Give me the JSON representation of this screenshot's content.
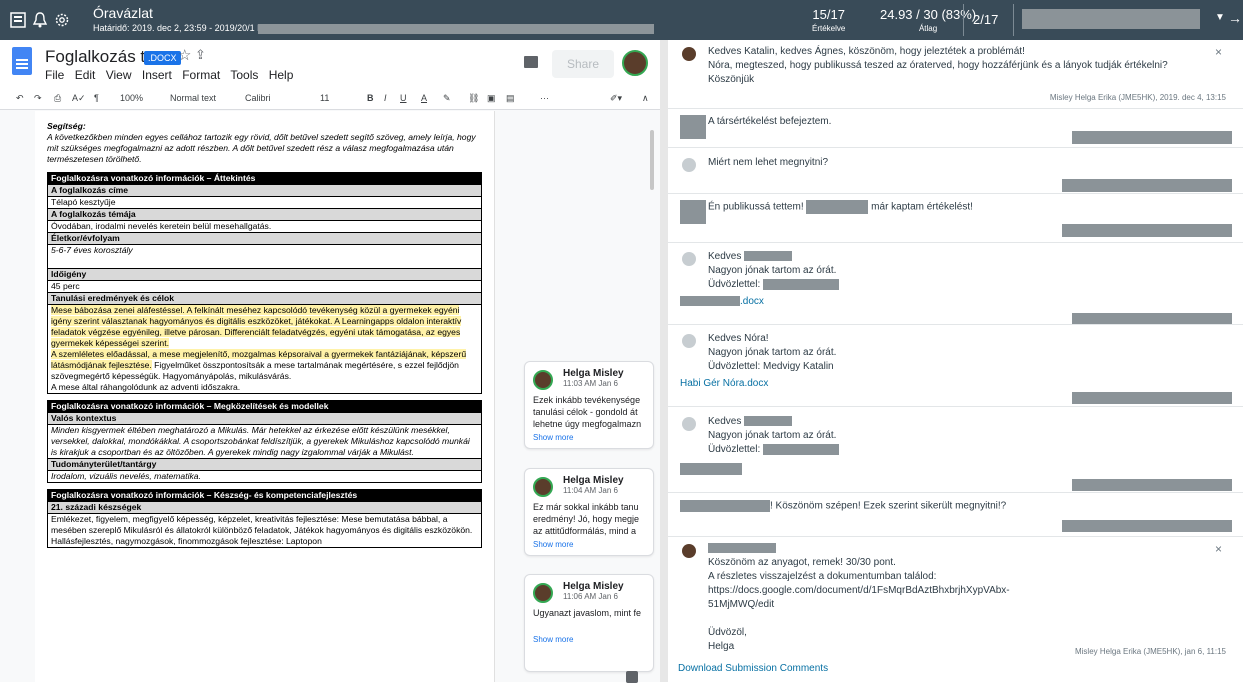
{
  "topbar": {
    "assignment_title": "Óravázlat",
    "deadline": "Határidő: 2019. dec 2, 23:59 - 2019/20/1 PPK-",
    "graded_count": "15/17",
    "graded_label": "Értékelve",
    "score": "24.93 / 30 (83%)",
    "score_label": "Átlag",
    "student_pos": "2/17"
  },
  "doc": {
    "title": "Foglalkozás terv",
    "badge": ".DOCX",
    "menu": [
      "File",
      "Edit",
      "View",
      "Insert",
      "Format",
      "Tools",
      "Help"
    ],
    "share_label": "Share",
    "toolbar": {
      "zoom": "100%",
      "style": "Normal text",
      "font": "Calibri",
      "size": "11",
      "bold": "B",
      "italic": "I",
      "underline": "U",
      "color": "A",
      "more": "···"
    },
    "help_title": "Segítség:",
    "help_text": "A következőkben minden egyes cellához tartozik egy rövid, dőlt betűvel szedett segítő szöveg, amely leírja, hogy mit szükséges megfogalmazni az adott részben. A dőlt betűvel szedett rész a válasz megfogalmazása után természetesen törölhető.",
    "s1_head": "Foglalkozásra vonatkozó információk – Áttekintés",
    "r_cim": "A foglalkozás címe",
    "v_cim": "Télapó kesztyűje",
    "r_tema": "A foglalkozás témája",
    "v_tema": "Óvodában, irodalmi nevelés keretein belül mesehallgatás.",
    "r_kor": "Életkor/évfolyam",
    "v_kor": "5-6-7 éves korosztály",
    "r_ido": "Időigény",
    "v_ido": "45 perc",
    "r_cel": "Tanulási eredmények és célok",
    "v_cel1": "Mese bábozása zenei aláfestéssel. A felkínált meséhez kapcsolódó tevékenység közül a gyermekek egyéni igény szerint választanak hagyományos és digitális eszközöket, játékokat. A Learningapps oldalon interaktív feladatok végzése egyénileg, illetve párosan. Differenciált feladatvégzés, egyéni utak támogatása, az egyes gyermekek képességei szerint.",
    "v_cel2a": "A szemléletes előadással, a mese megjelenítő, mozgalmas képsoraival a gyermekek fantáziájának, képszerű látásmódjának fejlesztése.",
    "v_cel2b": " Figyelműket összpontosítsák a mese tartalmának megértésére, s ezzel fejlődjön szövegmegértő képességük. Hagyományápolás, mikulásvárás.",
    "v_cel3": "A mese által ráhangolódunk az adventi időszakra.",
    "s2_head": "Foglalkozásra vonatkozó információk – Megközelítések és modellek",
    "r_valos": "Valós kontextus",
    "v_valos": "Minden kisgyermek éltében meghatározó a Mikulás. Már hetekkel az érkezése előtt készülünk mesékkel, versekkel, dalokkal, mondókákkal. A csoportszobánkat feldíszítjük, a gyerekek Mikuláshoz kapcsolódó munkái is kirakjuk a csoportban és az öltözőben. A gyerekek mindig nagy izgalommal várják a Mikulást.",
    "r_tud": "Tudományterület/tantárgy",
    "v_tud": "Irodalom, vizuális nevelés, matematika.",
    "s3_head": "Foglalkozásra vonatkozó információk – Készség- és kompetenciafejlesztés",
    "r_21": "21. századi készségek",
    "v_21": "Emlékezet, figyelem, megfigyelő képesség, képzelet, kreativitás fejlesztése: Mese bemutatása bábbal, a mesében szereplő Mikulásról és állatokról különböző feladatok, Játékok hagyományos és digitális eszközökön. Hallásfejlesztés, nagymozgások, finommozgások fejlesztése: Laptopon"
  },
  "cards": [
    {
      "name": "Helga Misley",
      "time": "11:03 AM Jan 6",
      "body": "Ezek inkább tevékenysége\ntanulási célok - gondold át\nlehetne úgy megfogalmazn",
      "more": "Show more"
    },
    {
      "name": "Helga Misley",
      "time": "11:04 AM Jan 6",
      "body": "Ez már sokkal inkább tanu\neredmény! Jó, hogy megje\naz attitűdformálás, mind a",
      "more": "Show more"
    },
    {
      "name": "Helga Misley",
      "time": "11:06 AM Jan 6",
      "body": "Ugyanazt javaslom, mint fe",
      "more": "Show more"
    }
  ],
  "comments": {
    "c1_line1": "Kedves Katalin, kedves Ágnes, köszönöm, hogy jeleztétek a problémát!",
    "c1_line2": "Nóra, megteszed, hogy publikussá teszed az óraterved, hogy hozzáférjünk és a lányok tudják értékelni?",
    "c1_line3": "Köszönjük",
    "c1_meta": "Misley Helga Erika (JME5HK), 2019. dec 4, 13:15",
    "c2": "A társértékelést befejeztem.",
    "c3": "Miért nem lehet megnyitni?",
    "c4a": "Én publikussá tettem!",
    "c4b": "már kaptam értékelést!",
    "c5_greet": "Kedves",
    "c5_line": "Nagyon jónak tartom az órát.",
    "c5_sig": "Üdvözlettel:",
    "c5_file": ".docx",
    "c6_greet": "Kedves Nóra!",
    "c6_line": "Nagyon jónak tartom az órát.",
    "c6_sig": "Üdvözlettel: Medvigy Katalin",
    "c6_file": "Habi Gér Nóra.docx",
    "c7_greet": "Kedves",
    "c7_line": "Nagyon jónak tartom az órát.",
    "c7_sig": "Üdvözlettel:",
    "c8": "! Köszönöm szépen! Ezek szerint sikerült megnyitni!?",
    "c9_line1": "Köszönöm az anyagot, remek! 30/30 pont.",
    "c9_line2": "A részletes visszajelzést a dokumentumban találod: https://docs.google.com/document/d/1FsMqrBdAztBhxbrjhXypVAbx-",
    "c9_line3": "51MjMWQ/edit",
    "c9_line4": "Üdvözöl,",
    "c9_line5": "Helga",
    "c9_meta": "Misley Helga Erika (JME5HK), jan 6, 11:15",
    "download": "Download Submission Comments",
    "close": "×"
  }
}
